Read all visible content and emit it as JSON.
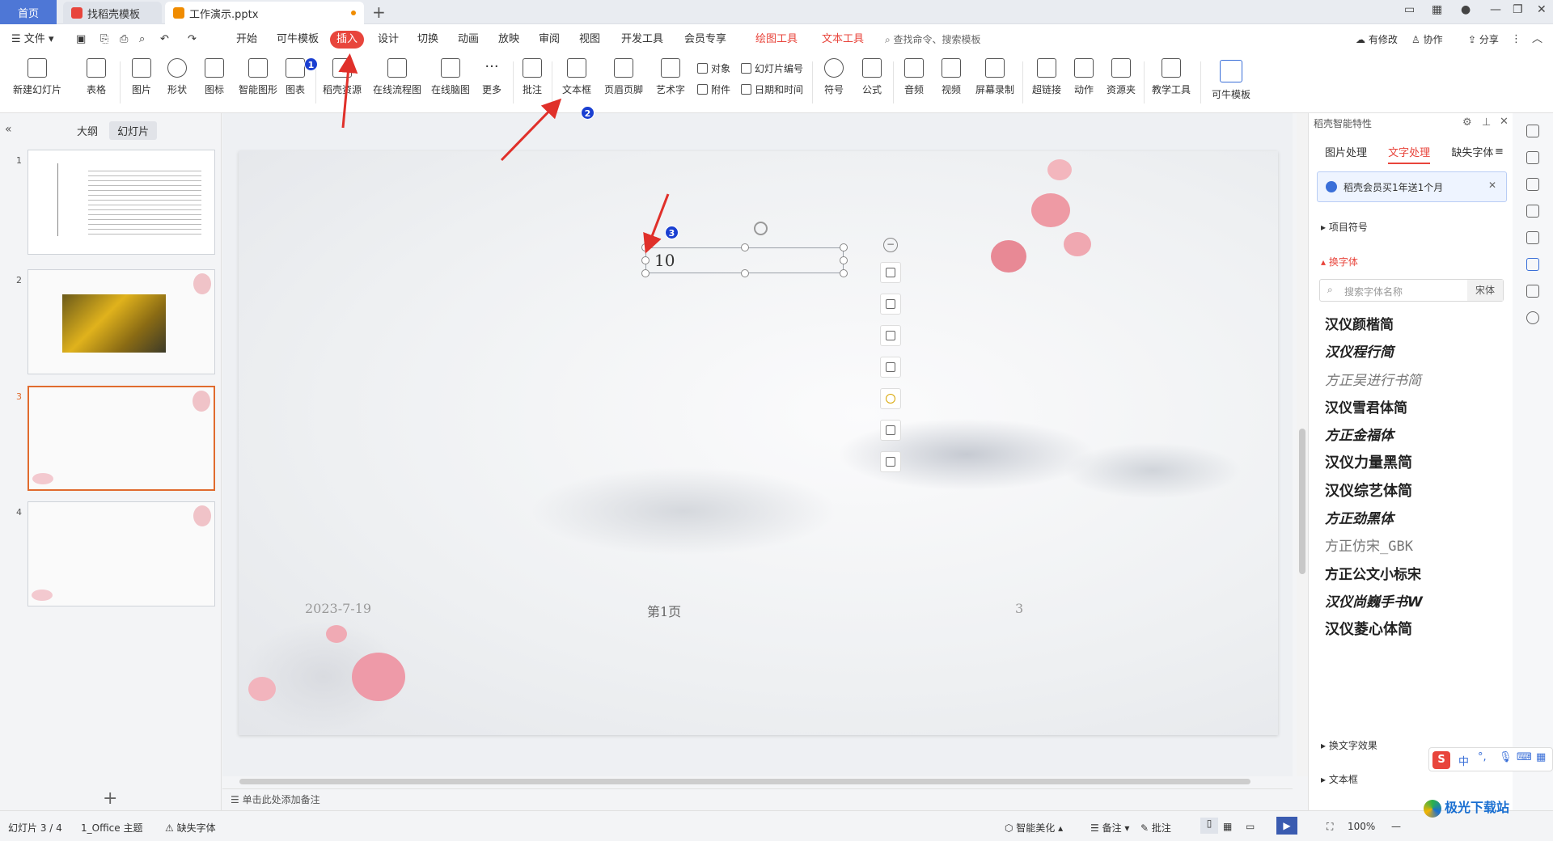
{
  "tabs": {
    "home": "首页",
    "template": "找稻壳模板",
    "doc": "工作演示.pptx"
  },
  "menu": {
    "file": "文件",
    "items": [
      "开始",
      "可牛模板",
      "插入",
      "设计",
      "切换",
      "动画",
      "放映",
      "审阅",
      "视图",
      "开发工具",
      "会员专享",
      "绘图工具",
      "文本工具"
    ],
    "search": "查找命令、搜索模板",
    "right": [
      "有修改",
      "协作",
      "分享"
    ]
  },
  "ribbon": {
    "buttons": [
      "新建幻灯片",
      "表格",
      "图片",
      "形状",
      "图标",
      "智能图形",
      "图表",
      "稻壳资源",
      "在线流程图",
      "在线脑图",
      "更多",
      "批注",
      "文本框",
      "页眉页脚",
      "艺术字",
      "符号",
      "公式",
      "音频",
      "视频",
      "屏幕录制",
      "超链接",
      "动作",
      "资源夹",
      "教学工具",
      "可牛模板"
    ],
    "small": [
      "对象",
      "幻灯片编号",
      "附件",
      "日期和时间"
    ]
  },
  "leftpanel": {
    "tabs": [
      "大纲",
      "幻灯片"
    ],
    "numbers": [
      "1",
      "2",
      "3",
      "4"
    ]
  },
  "slide": {
    "textbox_value": "10",
    "date": "2023-7-19",
    "page_label": "第1页",
    "page_num": "3"
  },
  "notes": "单击此处添加备注",
  "rightpanel": {
    "title": "稻壳智能特性",
    "tabs": [
      "图片处理",
      "文字处理",
      "缺失字体"
    ],
    "banner": "稻壳会员买1年送1个月",
    "sec_bullets": "项目符号",
    "sec_font": "换字体",
    "search_placeholder": "搜索字体名称",
    "current_font": "宋体",
    "fonts": [
      "汉仪颜楷简",
      "汉仪程行简",
      "方正吴进行书简",
      "汉仪雪君体简",
      "方正金福体",
      "汉仪力量黑简",
      "汉仪综艺体简",
      "方正劲黑体",
      "方正仿宋_GBK",
      "方正公文小标宋",
      "汉仪尚巍手书W",
      "汉仪菱心体简"
    ],
    "sec_effect": "换文字效果",
    "sec_textbox": "文本框"
  },
  "status": {
    "slide": "幻灯片 3 / 4",
    "theme": "1_Office 主题",
    "missing": "缺失字体",
    "beautify": "智能美化",
    "notes": "备注",
    "comment": "批注",
    "zoom": "100%"
  },
  "badges": [
    "1",
    "2",
    "3"
  ],
  "ime": "中",
  "watermark": "极光下载站"
}
